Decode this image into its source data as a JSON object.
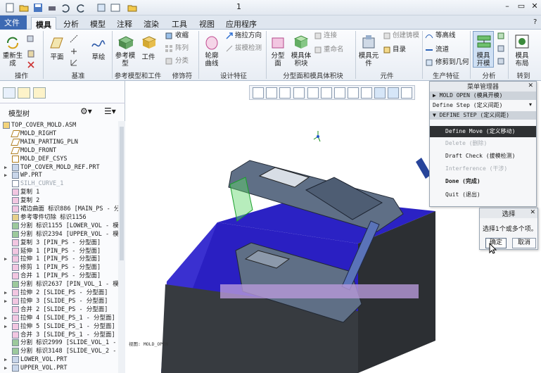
{
  "quick_access": {
    "title": "1",
    "min": "–",
    "restore": "▭",
    "close": "✕",
    "help": "?"
  },
  "tabs": [
    "文件",
    "模具",
    "分析",
    "模型",
    "注释",
    "渲染",
    "工具",
    "视图",
    "应用程序"
  ],
  "active_tab": "模具",
  "ribbon": {
    "buttons": {
      "regenerate": "重新生\n成",
      "plane": "平面",
      "sketch": "草绘",
      "ref_model": "参考模\n型",
      "workpiece": "工件",
      "shrink": "收缩",
      "array": "阵列",
      "classify": "分类",
      "contour_curve": "轮廓\n曲线",
      "draw_direction": "拖拉方向",
      "draft_check": "拔模检测",
      "parting_surface": "分型\n面",
      "mold_volume": "模具体\n积块",
      "connect": "连接",
      "rename": "重命名",
      "mold_element": "模具元\n件",
      "create_casting": "创建铸模",
      "catalog": "目录",
      "isoline": "等高线",
      "runner": "流道",
      "trim_to_geometry": "修剪到几何",
      "mold_open": "模具\n开模",
      "mold_layout": "模具\n布局"
    },
    "groups": [
      "操作",
      "基准",
      "参考模型和工件",
      "修饰符",
      "设计特征",
      "分型面和模具体积块",
      "元件",
      "生产特征",
      "分析",
      "转到"
    ]
  },
  "model_tree": {
    "title": "模型树",
    "items": [
      {
        "text": "TOP_COVER_MOLD.ASM",
        "exp": "",
        "icon": "asm"
      },
      {
        "text": "MOLD_RIGHT",
        "exp": "",
        "icon": "plane"
      },
      {
        "text": "MAIN_PARTING_PLN",
        "exp": "",
        "icon": "plane"
      },
      {
        "text": "MOLD_FRONT",
        "exp": "",
        "icon": "plane"
      },
      {
        "text": "MOLD_DEF_CSYS",
        "exp": "",
        "icon": "csys"
      },
      {
        "text": "TOP_COVER_MOLD_REF.PRT",
        "exp": "▶",
        "icon": "part"
      },
      {
        "text": "WP.PRT",
        "exp": "▶",
        "icon": "part"
      },
      {
        "text": "SILH_CURVE_1",
        "exp": "",
        "icon": "curve",
        "dim": true
      },
      {
        "text": "复制 1",
        "exp": "",
        "icon": "surf"
      },
      {
        "text": "复制 2",
        "exp": "",
        "icon": "surf"
      },
      {
        "text": "裙边曲面 标识886 [MAIN_PS - 分",
        "exp": "",
        "icon": "surf"
      },
      {
        "text": "参考零件切除 标识1156",
        "exp": "",
        "icon": "cut"
      },
      {
        "text": "分割 标识1155 [LOWER_VOL - 模",
        "exp": "",
        "icon": "split"
      },
      {
        "text": "分割 标识2394 [UPPER_VOL - 模",
        "exp": "",
        "icon": "split"
      },
      {
        "text": "复制 3 [PIN_PS - 分型面]",
        "exp": "",
        "icon": "surf"
      },
      {
        "text": "延伸 1 [PIN_PS - 分型面]",
        "exp": "",
        "icon": "surf"
      },
      {
        "text": "拉伸 1 [PIN_PS - 分型面]",
        "exp": "▶",
        "icon": "ext"
      },
      {
        "text": "修剪 1 [PIN_PS - 分型面]",
        "exp": "",
        "icon": "surf"
      },
      {
        "text": "合并 1 [PIN_PS - 分型面]",
        "exp": "",
        "icon": "surf"
      },
      {
        "text": "分割 标识2637 [PIN_VOL_1 - 模",
        "exp": "",
        "icon": "split"
      },
      {
        "text": "拉伸 2 [SLIDE_PS - 分型面]",
        "exp": "▶",
        "icon": "ext"
      },
      {
        "text": "拉伸 3 [SLIDE_PS - 分型面]",
        "exp": "▶",
        "icon": "ext"
      },
      {
        "text": "合并 2 [SLIDE_PS - 分型面]",
        "exp": "",
        "icon": "surf"
      },
      {
        "text": "拉伸 4 [SLIDE_PS_1 - 分型面]",
        "exp": "▶",
        "icon": "ext"
      },
      {
        "text": "拉伸 5 [SLIDE_PS_1 - 分型面]",
        "exp": "▶",
        "icon": "ext"
      },
      {
        "text": "合并 3 [SLIDE_PS_1 - 分型面]",
        "exp": "",
        "icon": "surf"
      },
      {
        "text": "分割 标识2999 [SLIDE_VOL_1 -",
        "exp": "",
        "icon": "split"
      },
      {
        "text": "分割 标识3148 [SLIDE_VOL_2 -",
        "exp": "",
        "icon": "split"
      },
      {
        "text": "LOWER_VOL.PRT",
        "exp": "▶",
        "icon": "part"
      },
      {
        "text": "UPPER_VOL.PRT",
        "exp": "▶",
        "icon": "part"
      }
    ]
  },
  "menu_manager": {
    "title": "菜单管理器",
    "rows": [
      {
        "text": "▶ MOLD OPEN (模具开模)",
        "style": "hdr"
      },
      {
        "text": "Define Step (定义间距)",
        "style": "",
        "arrow": "▾"
      },
      {
        "text": "▼ DEFINE STEP (定义间距)",
        "style": "hdr"
      },
      {
        "text": "Define Move (定义移动)",
        "style": "sel"
      },
      {
        "text": "Delete (删除)",
        "style": "dis"
      },
      {
        "text": "Draft Check (拔模检测)",
        "style": ""
      },
      {
        "text": "Interference (干涉)",
        "style": "dis"
      },
      {
        "text": "Done (完成)",
        "style": "bold"
      },
      {
        "text": "Quit (退出)",
        "style": ""
      }
    ]
  },
  "select_dialog": {
    "title": "选择",
    "message": "选择1个或多个项。",
    "ok": "确定",
    "cancel": "取消"
  },
  "viewport_note": "视图: MOLD_OPEN",
  "colors": {
    "workpiece": "#2b22c4",
    "part": "#5f6f86",
    "pin": "#5a73b8",
    "menu_sel": "#2f3133"
  }
}
